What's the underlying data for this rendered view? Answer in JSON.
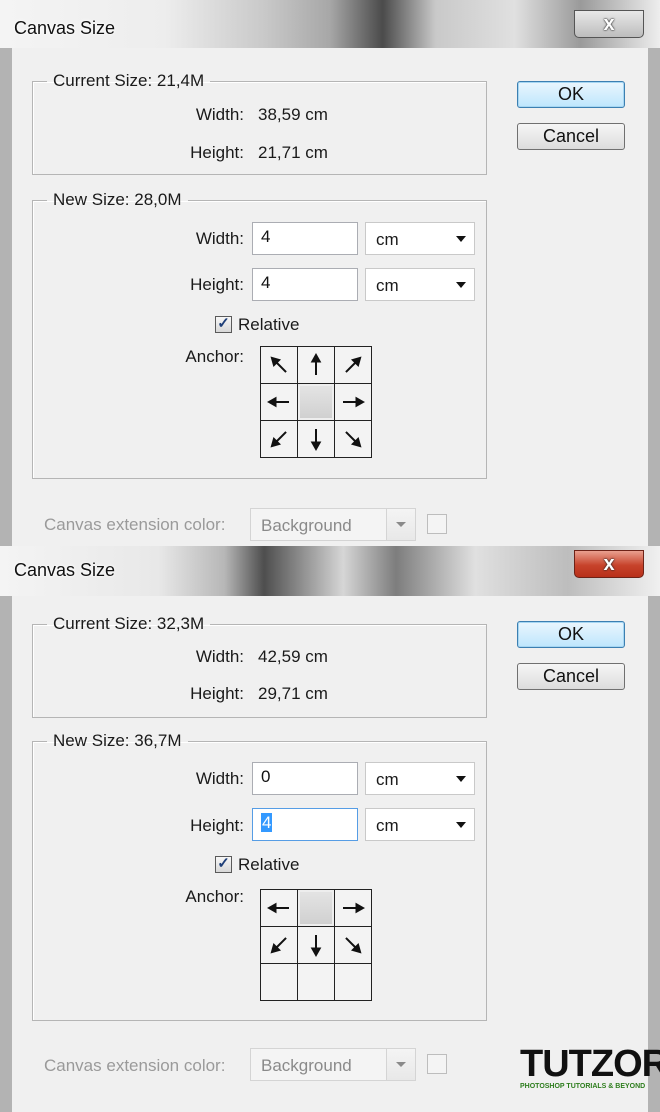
{
  "dialogs": [
    {
      "title": "Canvas Size",
      "current_size": {
        "label": "Current Size: 21,4M",
        "width_label": "Width:",
        "width_value": "38,59 cm",
        "height_label": "Height:",
        "height_value": "21,71 cm"
      },
      "new_size": {
        "label": "New Size: 28,0M",
        "width_label": "Width:",
        "width_value": "4",
        "width_unit": "cm",
        "height_label": "Height:",
        "height_value": "4",
        "height_unit": "cm"
      },
      "relative": {
        "label": "Relative",
        "checked": true
      },
      "anchor_label": "Anchor:",
      "anchor_position": "center",
      "anchor_cells": [
        "arrow-nw",
        "arrow-up",
        "arrow-ne",
        "arrow-left",
        "anchor-center",
        "arrow-right",
        "arrow-sw",
        "arrow-down",
        "arrow-se"
      ],
      "extension": {
        "label": "Canvas extension color:",
        "value": "Background"
      },
      "buttons": {
        "ok": "OK",
        "cancel": "Cancel"
      },
      "close_symbol": "x"
    },
    {
      "title": "Canvas Size",
      "current_size": {
        "label": "Current Size: 32,3M",
        "width_label": "Width:",
        "width_value": "42,59 cm",
        "height_label": "Height:",
        "height_value": "29,71 cm"
      },
      "new_size": {
        "label": "New Size: 36,7M",
        "width_label": "Width:",
        "width_value": "0",
        "width_unit": "cm",
        "height_label": "Height:",
        "height_value": "4",
        "height_unit": "cm"
      },
      "relative": {
        "label": "Relative",
        "checked": true
      },
      "anchor_label": "Anchor:",
      "anchor_position": "top-center",
      "anchor_cells": [
        "arrow-left",
        "anchor-center",
        "arrow-right",
        "arrow-sw",
        "arrow-down",
        "arrow-se",
        "empty",
        "empty",
        "empty"
      ],
      "extension": {
        "label": "Canvas extension color:",
        "value": "Background"
      },
      "buttons": {
        "ok": "OK",
        "cancel": "Cancel"
      },
      "close_symbol": "x"
    }
  ],
  "logo": {
    "brand": "TUTZOR",
    "tagline": "PHOTOSHOP TUTORIALS & BEYOND"
  },
  "colors": {
    "close_button_active": "#c7432b",
    "ok_button": "#bee6fd",
    "logo_tagline": "#2d7d1d"
  }
}
